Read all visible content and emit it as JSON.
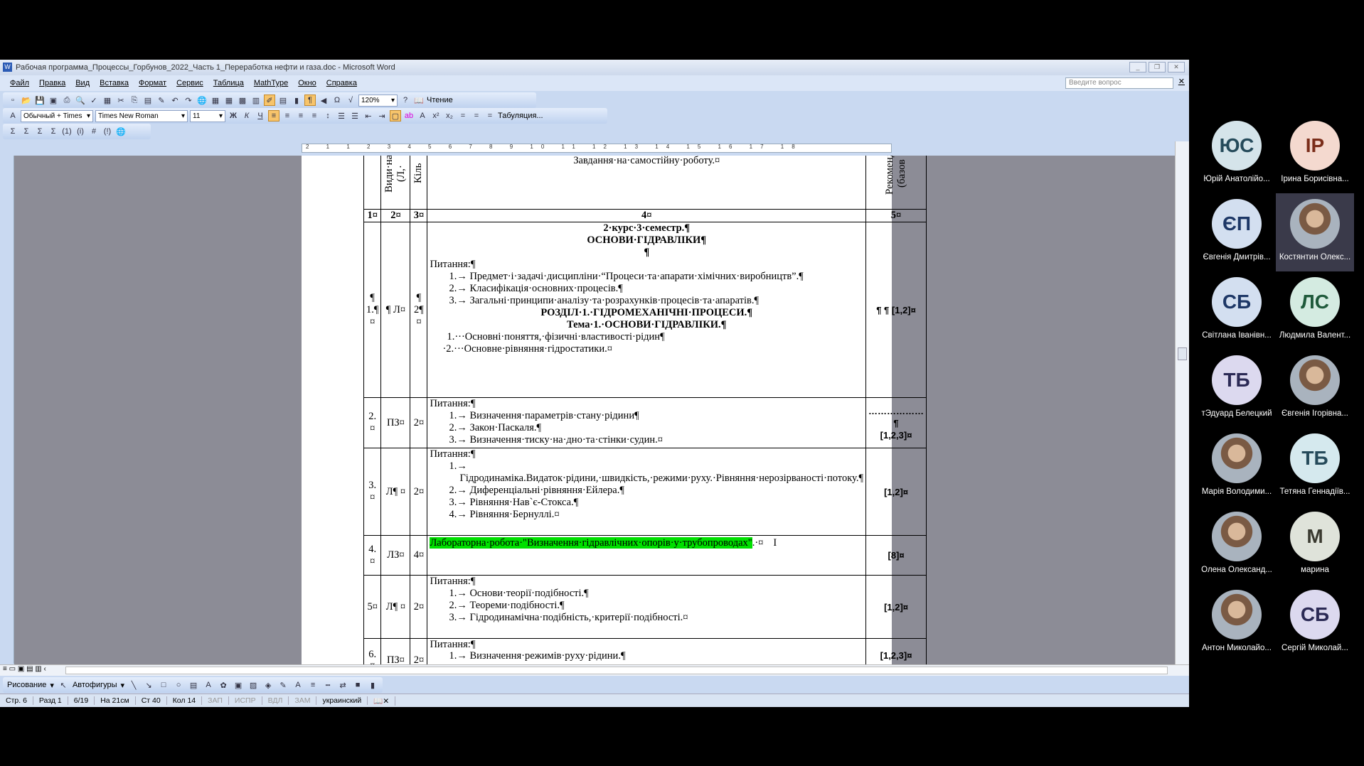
{
  "window": {
    "title": "Рабочая программа_Процессы_Горбунов_2022_Часть 1_Переработка нефти и газа.doc - Microsoft Word"
  },
  "menu": [
    "Файл",
    "Правка",
    "Вид",
    "Вставка",
    "Формат",
    "Сервис",
    "Таблица",
    "MathType",
    "Окно",
    "Справка"
  ],
  "ask_placeholder": "Введите вопрос",
  "toolbar": {
    "zoom": "120%",
    "reading": "Чтение",
    "style": "Обычный + Times",
    "font": "Times New Roman",
    "size": "11",
    "tabs": "Табуляция..."
  },
  "ruler_numbers": "2 1 1 2 3 4 5 6 7 8 9 10 11 12 13 14 15 16 17 18",
  "table": {
    "header": {
      "c2": "Види·на (Л,·",
      "c3": "Кіль",
      "c4": "Завдання·на·самостійну·роботу.¤",
      "c5": "Рекоменд (базов"
    },
    "numbers": [
      "1¤",
      "2¤",
      "3¤",
      "4¤",
      "5¤"
    ],
    "rows": [
      {
        "n": "¶ 1.¶ ¤",
        "type": "¶ Л¤",
        "hours": "¶ 2¶ ¤",
        "ref": "¶ ¶ [1,2]¤",
        "head1": "2·курс·3·семестр.¶",
        "head2": "ОСНОВИ·ГІДРАВЛІКИ¶",
        "blank": "¶",
        "label": "Питання:¶",
        "items": [
          "1.→ Предмет·і·задачі·дисципліни·“Процеси·та·апарати·хімічних·виробництв”.¶",
          "2.→ Класифікація·основних·процесів.¶",
          "3.→ Загальні·принципи·аналізу·та·розрахунків·процесів·та·апаратів.¶"
        ],
        "section": "РОЗДІЛ·1.·ГІДРОМЕХАНІЧНІ·ПРОЦЕСИ.¶",
        "topic": "Тема·1.·ОСНОВИ·ГІДРАВЛІКИ.¶",
        "items2": [
          "1.···Основні·поняття,·фізичні·властивості·рідин¶",
          "·2.···Основне·рівняння·гідростатики.¤"
        ]
      },
      {
        "n": "2.¤",
        "type": "ПЗ¤",
        "hours": "2¤",
        "ref1": "………………¶",
        "ref": "[1,2,3]¤",
        "label": "Питання:¶",
        "items": [
          "1.→ Визначення·параметрів·стану·рідини¶",
          "2.→ Закон·Паскаля.¶",
          "3.→ Визначення·тиску·на·дно·та·стінки·судин.¤"
        ]
      },
      {
        "n": "3.¤",
        "type": "Л¶ ¤",
        "hours": "2¤",
        "ref": "[1,2]¤",
        "label": "Питання:¶",
        "items": [
          "1.→ Гідродинаміка.Видаток·рідини,·швидкість,·режими·руху.·Рівняння·нерозірваності·потоку.¶",
          "2.→ Диференціальні·рівняння·Ейлера.¶",
          "3.→ Рівняння·Нав`є-Стокса.¶",
          "4.→ Рівняння·Бернуллі.¤"
        ]
      },
      {
        "n": "4.¤",
        "type": "ЛЗ¤",
        "hours": "4¤",
        "ref": "[8]¤",
        "lab": "Лабораторна·робота·\"Визначення·гідравлічних·опорів·у·трубопроводах\"",
        "lab_end": ".·¤"
      },
      {
        "n": "5¤",
        "type": "Л¶ ¤",
        "hours": "2¤",
        "ref": "[1,2]¤",
        "label": "Питання:¶",
        "items": [
          "1.→ Основи·теорії·подібності.¶",
          "2.→ Теореми·подібності.¶",
          "3.→ Гідродинамічна·подібність,·критерії·подібності.¤"
        ]
      },
      {
        "n": "6.¤",
        "type": "ПЗ¤",
        "hours": "2¤",
        "ref": "[1,2,3]¤",
        "label": "Питання:¶",
        "items": [
          "1.→ Визначення·режимів·руху·рідини.¶"
        ]
      }
    ]
  },
  "drawing": {
    "draw": "Рисование",
    "autoshapes": "Автофигуры"
  },
  "status": [
    "Стр. 6",
    "Разд 1",
    "6/19",
    "На 21см",
    "Ст 40",
    "Кол 14",
    "ЗАП",
    "ИСПР",
    "ВДЛ",
    "ЗАМ",
    "украинский"
  ],
  "participants": [
    {
      "initials": "ЮС",
      "name": "Юрій Анатолійо...",
      "bg": "#d5e4ea",
      "fg": "#254a5a"
    },
    {
      "initials": "ІР",
      "name": "Ірина Борисівна...",
      "bg": "#f4d9cf",
      "fg": "#7a2d1a"
    },
    {
      "initials": "ЄП",
      "name": "Євгенія Дмитрів...",
      "bg": "#d3dff0",
      "fg": "#1d3766"
    },
    {
      "initials": "",
      "name": "Костянтин Олекс...",
      "photo": true
    },
    {
      "initials": "СБ",
      "name": "Світлана Іванівн...",
      "bg": "#d3dff0",
      "fg": "#1d3766"
    },
    {
      "initials": "ЛС",
      "name": "Людмила Валент...",
      "bg": "#d4ebe1",
      "fg": "#1f5a3b"
    },
    {
      "initials": "ТБ",
      "name": "тЭдуард Белецкий",
      "bg": "#dcd9ef",
      "fg": "#2b2a55"
    },
    {
      "initials": "",
      "name": "Євгенія Ігорівна...",
      "photo": true
    },
    {
      "initials": "",
      "name": "Марія Володими...",
      "photo": true
    },
    {
      "initials": "ТБ",
      "name": "Тетяна Геннадіїв...",
      "bg": "#d5e9ee",
      "fg": "#254a5a"
    },
    {
      "initials": "",
      "name": "Олена Олександ...",
      "photo": true
    },
    {
      "initials": "М",
      "name": "марина",
      "bg": "#dfe3da",
      "fg": "#3a3a30"
    },
    {
      "initials": "",
      "name": "Антон Миколайо...",
      "photo": true
    },
    {
      "initials": "СБ",
      "name": "Сергій Миколай...",
      "bg": "#dcd9ef",
      "fg": "#2b2a55"
    }
  ]
}
